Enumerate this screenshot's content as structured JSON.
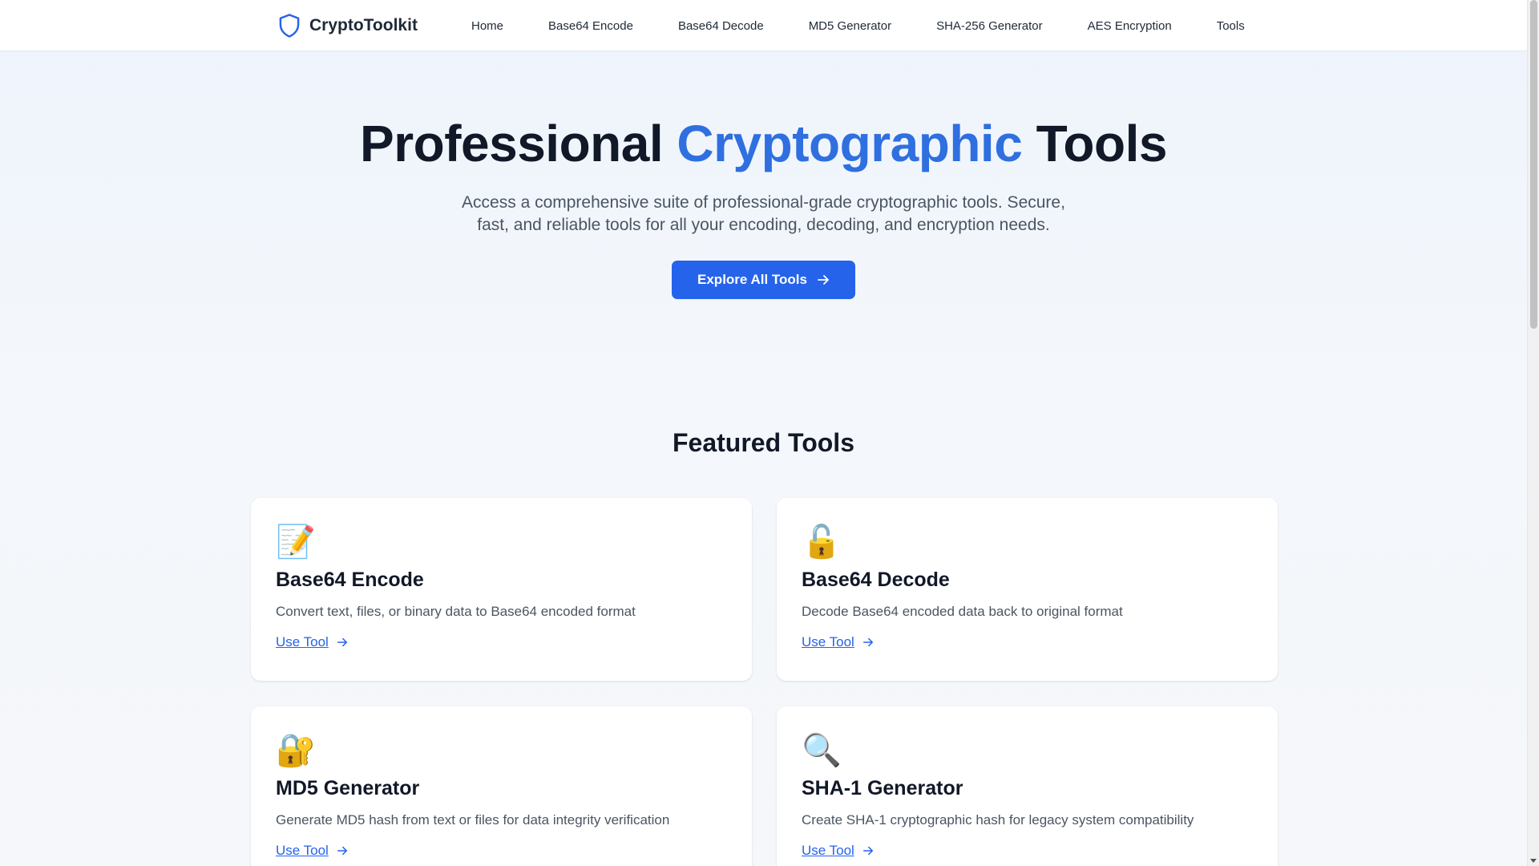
{
  "brand": {
    "name": "CryptoToolkit",
    "icon": "shield-icon"
  },
  "nav": {
    "items": [
      {
        "label": "Home"
      },
      {
        "label": "Base64 Encode"
      },
      {
        "label": "Base64 Decode"
      },
      {
        "label": "MD5 Generator"
      },
      {
        "label": "SHA-256 Generator"
      },
      {
        "label": "AES Encryption"
      },
      {
        "label": "Tools"
      }
    ]
  },
  "hero": {
    "title_before": "Professional ",
    "title_accent": "Cryptographic",
    "title_after": " Tools",
    "subtitle": "Access a comprehensive suite of professional-grade cryptographic tools. Secure, fast, and reliable tools for all your encoding, decoding, and encryption needs.",
    "cta_label": "Explore All Tools"
  },
  "featured": {
    "title": "Featured Tools",
    "cards": [
      {
        "emoji": "📝",
        "title": "Base64 Encode",
        "desc": "Convert text, files, or binary data to Base64 encoded format",
        "link": "Use Tool"
      },
      {
        "emoji": "🔓",
        "title": "Base64 Decode",
        "desc": "Decode Base64 encoded data back to original format",
        "link": "Use Tool"
      },
      {
        "emoji": "🔐",
        "title": "MD5 Generator",
        "desc": "Generate MD5 hash from text or files for data integrity verification",
        "link": "Use Tool"
      },
      {
        "emoji": "🔍",
        "title": "SHA-1 Generator",
        "desc": "Create SHA-1 cryptographic hash for legacy system compatibility",
        "link": "Use Tool"
      }
    ]
  },
  "colors": {
    "accent": "#2563eb",
    "heading_accent": "#2f6fe0"
  }
}
